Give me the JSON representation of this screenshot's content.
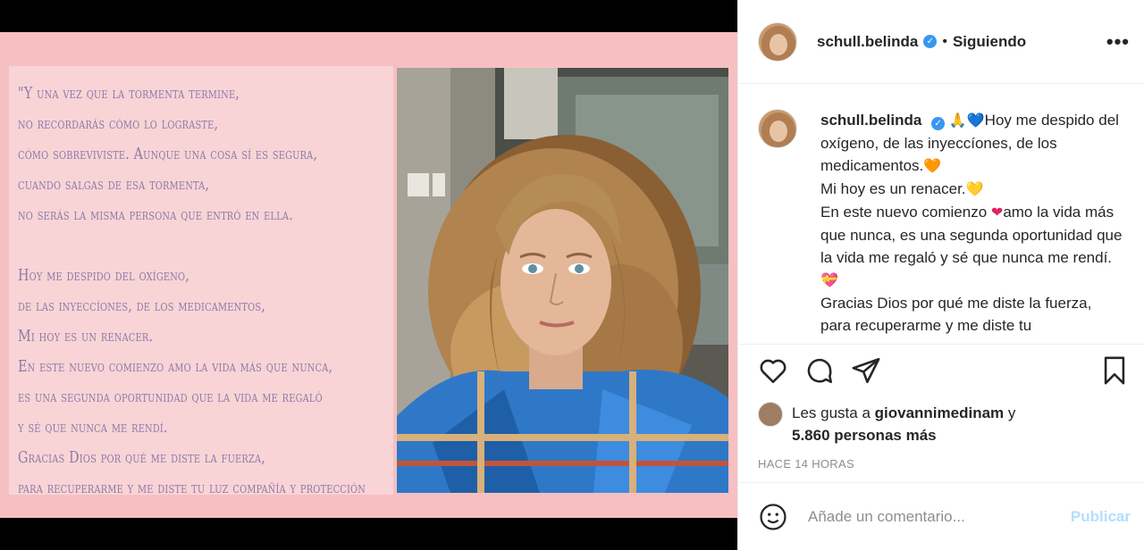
{
  "post_image": {
    "quote_lines_block1": [
      "\"Y una vez que la tormenta termine,",
      "no recordarás cómo lo lograste,",
      "cómo sobreviviste. Aunque una cosa sí es segura,",
      "cuando salgas de esa tormenta,",
      "no serás la misma persona que entró en ella."
    ],
    "quote_lines_block2": [
      "Hoy me despido del oxígeno,",
      "de las inyeccíones, de los medicamentos,",
      "Mi hoy es un renacer.",
      "En este nuevo comienzo amo la vida más que nunca,",
      " es una segunda oportunidad que la vida me regaló",
      " y sé que nunca me rendí.",
      "Gracias Dios por qué me diste la fuerza,",
      " para recuperarme y me diste tu luz compañía y protección"
    ]
  },
  "header": {
    "username": "schull.belinda",
    "separator": "•",
    "follow_status": "Siguiendo",
    "more_label": "•••"
  },
  "caption": {
    "username": "schull.belinda",
    "lines": [
      "Hoy me despido del oxígeno, de las inyeccíones, de los medicamentos.",
      "Mi hoy es un renacer.",
      "En este nuevo comienzo",
      "amo la vida más que nunca, es una segunda oportunidad que la vida me regaló y sé que nunca me rendí.",
      "Gracias Dios por qué me diste la fuerza, para recuperarme y me diste tu"
    ],
    "emojis": {
      "pray": "🙏",
      "blue_heart": "💙",
      "orange_heart": "🧡",
      "yellow_heart": "💛",
      "red_heart": "❤",
      "heart_ribbon": "💝"
    }
  },
  "likes": {
    "prefix": "Les gusta a",
    "user": "giovannimedinam",
    "conj": "y",
    "count_text": "5.860 personas más"
  },
  "timestamp": "HACE 14 HORAS",
  "comment": {
    "placeholder": "Añade un comentario...",
    "publish_label": "Publicar"
  },
  "colors": {
    "verified": "#3897f0",
    "publish": "#b2dffc",
    "frame_pink": "#f6c0c2",
    "quote_text": "#8b7aa8"
  },
  "icons": [
    "heart-icon",
    "comment-icon",
    "share-icon",
    "bookmark-icon",
    "smiley-icon",
    "verified-icon"
  ]
}
